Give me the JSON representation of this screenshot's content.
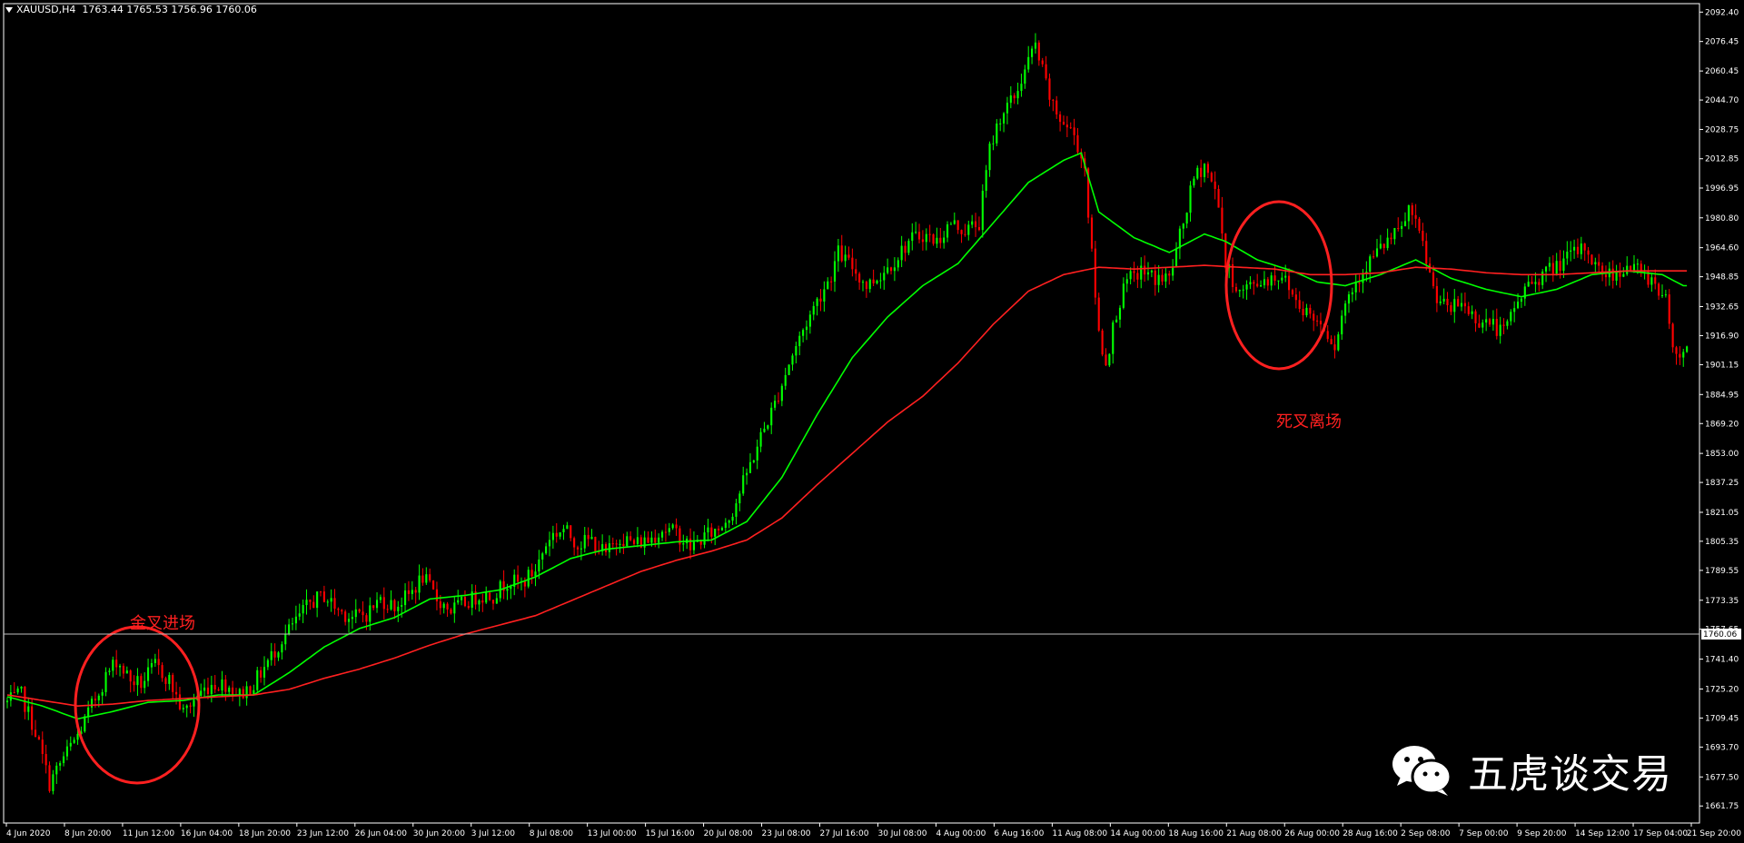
{
  "header": {
    "symbol": "XAUUSD,H4",
    "ohlc": "1763.44 1765.53 1756.96 1760.06"
  },
  "watermark": {
    "text": "五虎谈交易",
    "icon": "wechat-icon"
  },
  "annotations": {
    "golden_cross": "金叉进场",
    "death_cross": "死叉离场"
  },
  "colors": {
    "background": "#000000",
    "bull_candle": "#00ff00",
    "bear_candle": "#ff0000",
    "fast_ma": "#00ff00",
    "slow_ma": "#ff2020",
    "annotation": "#ff2020",
    "axis_text": "#ffffff",
    "current_price_line": "#c0c0c0"
  },
  "chart_data": {
    "type": "candlestick",
    "symbol": "XAUUSD",
    "timeframe": "H4",
    "current_price": 1760.06,
    "current_price_label": "1760.06",
    "ylim": [
      1653,
      2096
    ],
    "y_ticks": [
      "2092.40",
      "2076.45",
      "2060.45",
      "2044.70",
      "2028.75",
      "2012.85",
      "1996.95",
      "1980.80",
      "1964.60",
      "1948.85",
      "1932.65",
      "1916.90",
      "1901.15",
      "1884.95",
      "1869.20",
      "1853.00",
      "1837.25",
      "1821.05",
      "1805.35",
      "1789.55",
      "1773.35",
      "1757.65",
      "1741.40",
      "1725.20",
      "1709.45",
      "1693.70",
      "1677.50",
      "1661.75"
    ],
    "x_ticks": [
      "4 Jun 2020",
      "8 Jun 20:00",
      "11 Jun 12:00",
      "16 Jun 04:00",
      "18 Jun 20:00",
      "23 Jun 12:00",
      "26 Jun 04:00",
      "30 Jun 20:00",
      "3 Jul 12:00",
      "8 Jul 08:00",
      "13 Jul 00:00",
      "15 Jul 16:00",
      "20 Jul 08:00",
      "23 Jul 08:00",
      "27 Jul 16:00",
      "30 Jul 08:00",
      "4 Aug 00:00",
      "6 Aug 16:00",
      "11 Aug 08:00",
      "14 Aug 00:00",
      "18 Aug 16:00",
      "21 Aug 08:00",
      "26 Aug 00:00",
      "28 Aug 16:00",
      "2 Sep 08:00",
      "7 Sep 00:00",
      "9 Sep 20:00",
      "14 Sep 12:00",
      "17 Sep 04:00",
      "21 Sep 20:00"
    ],
    "price_path": [
      [
        0,
        1718
      ],
      [
        4,
        1722
      ],
      [
        8,
        1702
      ],
      [
        12,
        1674
      ],
      [
        16,
        1688
      ],
      [
        20,
        1700
      ],
      [
        24,
        1716
      ],
      [
        28,
        1732
      ],
      [
        31,
        1741
      ],
      [
        35,
        1730
      ],
      [
        38,
        1728
      ],
      [
        42,
        1738
      ],
      [
        46,
        1730
      ],
      [
        50,
        1712
      ],
      [
        54,
        1722
      ],
      [
        58,
        1728
      ],
      [
        62,
        1728
      ],
      [
        66,
        1722
      ],
      [
        70,
        1728
      ],
      [
        74,
        1740
      ],
      [
        78,
        1752
      ],
      [
        82,
        1762
      ],
      [
        86,
        1772
      ],
      [
        90,
        1776
      ],
      [
        94,
        1768
      ],
      [
        98,
        1764
      ],
      [
        102,
        1766
      ],
      [
        106,
        1774
      ],
      [
        110,
        1770
      ],
      [
        114,
        1776
      ],
      [
        118,
        1786
      ],
      [
        122,
        1774
      ],
      [
        126,
        1768
      ],
      [
        130,
        1772
      ],
      [
        134,
        1776
      ],
      [
        138,
        1776
      ],
      [
        142,
        1784
      ],
      [
        146,
        1782
      ],
      [
        150,
        1790
      ],
      [
        154,
        1808
      ],
      [
        158,
        1812
      ],
      [
        162,
        1804
      ],
      [
        166,
        1806
      ],
      [
        170,
        1798
      ],
      [
        174,
        1808
      ],
      [
        178,
        1804
      ],
      [
        182,
        1806
      ],
      [
        186,
        1812
      ],
      [
        190,
        1810
      ],
      [
        194,
        1802
      ],
      [
        198,
        1808
      ],
      [
        202,
        1812
      ],
      [
        206,
        1822
      ],
      [
        210,
        1842
      ],
      [
        214,
        1862
      ],
      [
        218,
        1880
      ],
      [
        222,
        1902
      ],
      [
        226,
        1920
      ],
      [
        230,
        1936
      ],
      [
        234,
        1950
      ],
      [
        236,
        1962
      ],
      [
        240,
        1954
      ],
      [
        244,
        1944
      ],
      [
        248,
        1950
      ],
      [
        252,
        1958
      ],
      [
        256,
        1968
      ],
      [
        260,
        1972
      ],
      [
        264,
        1968
      ],
      [
        268,
        1978
      ],
      [
        272,
        1974
      ],
      [
        276,
        1978
      ],
      [
        279,
        2018
      ],
      [
        282,
        2036
      ],
      [
        286,
        2046
      ],
      [
        290,
        2066
      ],
      [
        292,
        2074
      ],
      [
        294,
        2060
      ],
      [
        297,
        2040
      ],
      [
        300,
        2032
      ],
      [
        303,
        2026
      ],
      [
        306,
        2008
      ],
      [
        308,
        1960
      ],
      [
        310,
        1918
      ],
      [
        312,
        1902
      ],
      [
        315,
        1930
      ],
      [
        318,
        1946
      ],
      [
        322,
        1952
      ],
      [
        326,
        1948
      ],
      [
        330,
        1948
      ],
      [
        334,
        1978
      ],
      [
        337,
        2002
      ],
      [
        340,
        2010
      ],
      [
        344,
        1990
      ],
      [
        346,
        1955
      ],
      [
        350,
        1940
      ],
      [
        354,
        1945
      ],
      [
        358,
        1948
      ],
      [
        362,
        1950
      ],
      [
        366,
        1936
      ],
      [
        370,
        1928
      ],
      [
        374,
        1922
      ],
      [
        377,
        1912
      ],
      [
        380,
        1935
      ],
      [
        384,
        1950
      ],
      [
        388,
        1960
      ],
      [
        392,
        1968
      ],
      [
        396,
        1974
      ],
      [
        398,
        1986
      ],
      [
        402,
        1966
      ],
      [
        405,
        1942
      ],
      [
        409,
        1930
      ],
      [
        413,
        1935
      ],
      [
        417,
        1926
      ],
      [
        421,
        1924
      ],
      [
        425,
        1918
      ],
      [
        428,
        1932
      ],
      [
        432,
        1945
      ],
      [
        436,
        1950
      ],
      [
        440,
        1955
      ],
      [
        444,
        1960
      ],
      [
        448,
        1965
      ],
      [
        452,
        1952
      ],
      [
        456,
        1950
      ],
      [
        460,
        1955
      ],
      [
        465,
        1950
      ],
      [
        468,
        1946
      ],
      [
        471,
        1935
      ],
      [
        474,
        1905
      ],
      [
        476,
        1910
      ]
    ],
    "series": [
      {
        "type": "candlestick",
        "values_from": "price_path"
      },
      {
        "name": "",
        "type": "line",
        "color": "#00ff00",
        "points": [
          [
            0,
            1721
          ],
          [
            10,
            1716
          ],
          [
            20,
            1709
          ],
          [
            30,
            1713
          ],
          [
            40,
            1718
          ],
          [
            50,
            1719
          ],
          [
            60,
            1722
          ],
          [
            70,
            1722
          ],
          [
            80,
            1734
          ],
          [
            90,
            1748
          ],
          [
            100,
            1758
          ],
          [
            110,
            1764
          ],
          [
            120,
            1774
          ],
          [
            130,
            1776
          ],
          [
            140,
            1779
          ],
          [
            150,
            1786
          ],
          [
            160,
            1796
          ],
          [
            170,
            1801
          ],
          [
            180,
            1803
          ],
          [
            190,
            1805
          ],
          [
            200,
            1806
          ],
          [
            210,
            1816
          ],
          [
            220,
            1840
          ],
          [
            230,
            1874
          ],
          [
            240,
            1905
          ],
          [
            250,
            1927
          ],
          [
            260,
            1944
          ],
          [
            270,
            1956
          ],
          [
            280,
            1978
          ],
          [
            290,
            2000
          ],
          [
            300,
            2012
          ],
          [
            305,
            2016
          ],
          [
            310,
            1984
          ],
          [
            320,
            1970
          ],
          [
            330,
            1962
          ],
          [
            340,
            1972
          ],
          [
            346,
            1968
          ],
          [
            355,
            1958
          ],
          [
            365,
            1952
          ],
          [
            372,
            1946
          ],
          [
            380,
            1944
          ],
          [
            390,
            1950
          ],
          [
            400,
            1958
          ],
          [
            410,
            1948
          ],
          [
            420,
            1942
          ],
          [
            430,
            1938
          ],
          [
            440,
            1942
          ],
          [
            450,
            1950
          ],
          [
            460,
            1952
          ],
          [
            470,
            1950
          ],
          [
            476,
            1944
          ]
        ]
      },
      {
        "name": "",
        "type": "line",
        "color": "#ff2020",
        "points": [
          [
            0,
            1722
          ],
          [
            10,
            1719
          ],
          [
            20,
            1716
          ],
          [
            30,
            1717
          ],
          [
            40,
            1719
          ],
          [
            50,
            1720
          ],
          [
            60,
            1721
          ],
          [
            70,
            1722
          ],
          [
            80,
            1725
          ],
          [
            90,
            1731
          ],
          [
            100,
            1736
          ],
          [
            110,
            1742
          ],
          [
            120,
            1749
          ],
          [
            130,
            1755
          ],
          [
            140,
            1760
          ],
          [
            150,
            1765
          ],
          [
            160,
            1773
          ],
          [
            170,
            1781
          ],
          [
            180,
            1789
          ],
          [
            190,
            1795
          ],
          [
            200,
            1800
          ],
          [
            210,
            1806
          ],
          [
            220,
            1818
          ],
          [
            230,
            1836
          ],
          [
            240,
            1853
          ],
          [
            250,
            1870
          ],
          [
            260,
            1884
          ],
          [
            270,
            1902
          ],
          [
            280,
            1923
          ],
          [
            290,
            1941
          ],
          [
            300,
            1950
          ],
          [
            310,
            1954
          ],
          [
            320,
            1953
          ],
          [
            330,
            1954
          ],
          [
            340,
            1955
          ],
          [
            350,
            1954
          ],
          [
            360,
            1953
          ],
          [
            370,
            1950
          ],
          [
            380,
            1950
          ],
          [
            390,
            1951
          ],
          [
            400,
            1954
          ],
          [
            410,
            1953
          ],
          [
            420,
            1951
          ],
          [
            430,
            1950
          ],
          [
            440,
            1950
          ],
          [
            450,
            1951
          ],
          [
            460,
            1952
          ],
          [
            470,
            1952
          ],
          [
            476,
            1952
          ]
        ]
      }
    ],
    "grid": false,
    "legend": "none"
  }
}
